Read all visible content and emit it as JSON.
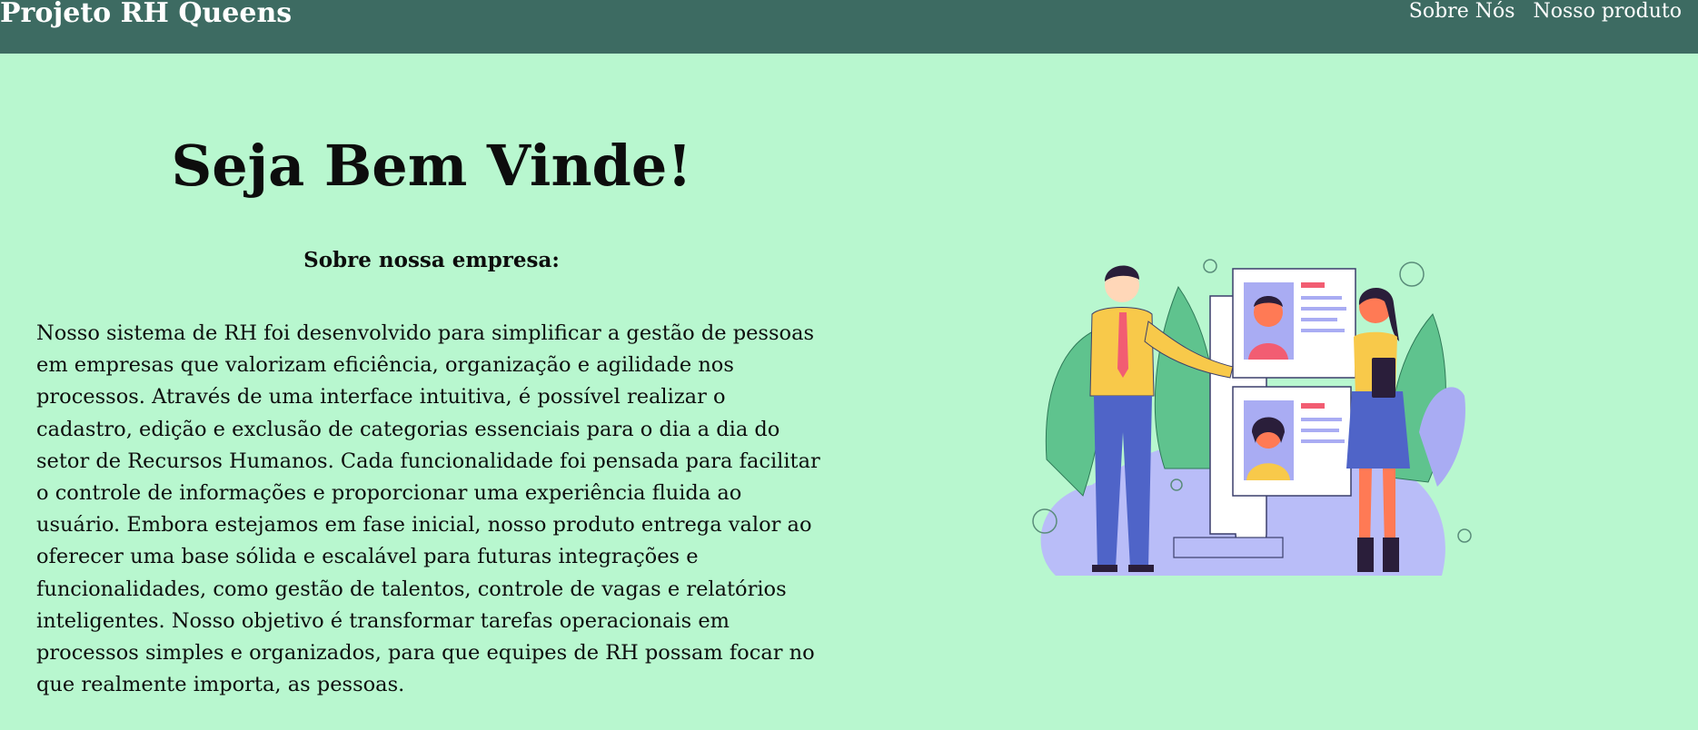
{
  "colors": {
    "page_background": "#b8f7cf",
    "navbar_background": "#3d6b62",
    "navbar_text": "#ffffff",
    "body_text": "#0d0d0d"
  },
  "navbar": {
    "brand": "Projeto RH Queens",
    "links": [
      {
        "label": "Sobre Nós"
      },
      {
        "label": "Nosso produto"
      }
    ]
  },
  "main": {
    "headline": "Seja Bem Vinde!",
    "subheading": "Sobre nossa empresa:",
    "paragraph": "Nosso sistema de RH foi desenvolvido para simplificar a gestão de pessoas em empresas que valorizam eficiência, organização e agilidade nos processos. Através de uma interface intuitiva, é possível realizar o cadastro, edição e exclusão de categorias essenciais para o dia a dia do setor de Recursos Humanos. Cada funcionalidade foi pensada para facilitar o controle de informações e proporcionar uma experiência fluida ao usuário. Embora estejamos em fase inicial, nosso produto entrega valor ao oferecer uma base sólida e escalável para futuras integrações e funcionalidades, como gestão de talentos, controle de vagas e relatórios inteligentes. Nosso objetivo é transformar tarefas operacionais em processos simples e organizados, para que equipes de RH possam focar no que realmente importa, as pessoas."
  },
  "illustration": {
    "icon": "hr-recruitment-illustration"
  }
}
